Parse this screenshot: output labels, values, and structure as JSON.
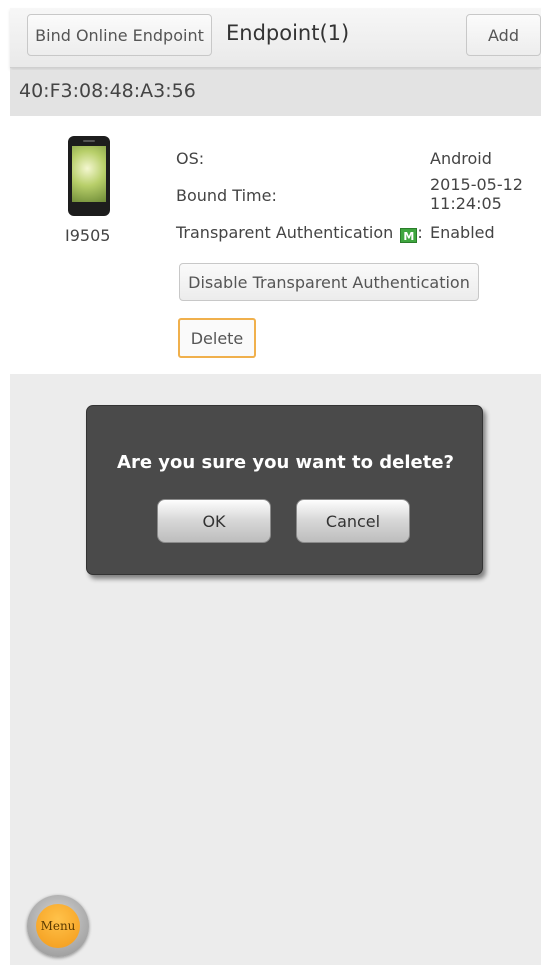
{
  "header": {
    "bind_button": "Bind Online Endpoint",
    "title": "Endpoint(1)",
    "add_button": "Add"
  },
  "device": {
    "mac": "40:F3:08:48:A3:56",
    "model": "I9505",
    "fields": {
      "os_label": "OS:",
      "os_value": "Android",
      "bound_label": "Bound Time:",
      "bound_date": "2015-05-12",
      "bound_time": "11:24:05",
      "auth_label": "Transparent Authentication",
      "auth_icon_letter": "M",
      "auth_colon": ":",
      "auth_value": "Enabled"
    },
    "disable_button": "Disable Transparent Authentication",
    "delete_button": "Delete"
  },
  "dialog": {
    "message": "Are you sure you want to delete?",
    "ok": "OK",
    "cancel": "Cancel"
  },
  "menu": {
    "label": "Menu"
  },
  "colors": {
    "accent": "#f0b04c",
    "dialog_bg": "#4a4a4a",
    "menu_orange": "#f39a1a"
  },
  "icons": [
    "phone-icon",
    "transparent-auth-icon",
    "menu-icon"
  ]
}
